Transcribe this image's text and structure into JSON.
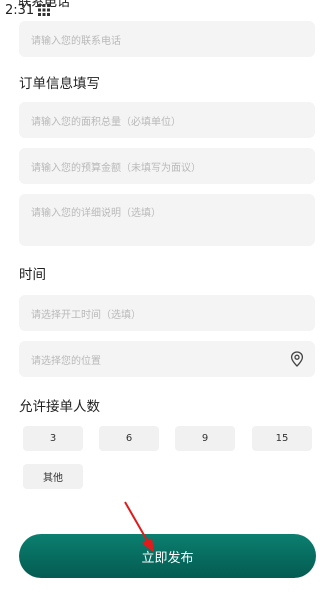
{
  "status_bar": {
    "time": "2:31"
  },
  "contact": {
    "partial_title": "联系电话",
    "phone_placeholder": "请输入您的联系电话"
  },
  "order_info": {
    "title": "订单信息填写",
    "area_placeholder": "请输入您的面积总量（必填单位）",
    "budget_placeholder": "请输入您的预算金额（未填写为面议）",
    "detail_placeholder": "请输入您的详细说明（选填）"
  },
  "time_section": {
    "title": "时间",
    "start_time_placeholder": "请选择开工时间（选填）",
    "location_placeholder": "请选择您的位置"
  },
  "allowed_count": {
    "title": "允许接单人数",
    "options": [
      "3",
      "6",
      "9",
      "15",
      "其他"
    ]
  },
  "submit_label": "立即发布",
  "icons": {
    "app": "grid-icon",
    "location": "location-pin-icon",
    "annotation": "red-arrow-icon"
  },
  "colors": {
    "accent": "#0b7f70",
    "arrow": "#e11b1b"
  }
}
